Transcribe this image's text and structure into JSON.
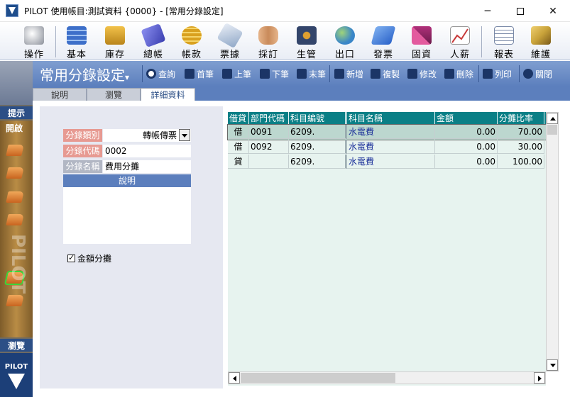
{
  "window": {
    "title": "PILOT 使用帳目:測試資料 {0000} - [常用分錄設定]",
    "controls": {
      "minimize": "─",
      "close": "✕"
    }
  },
  "toolbar": {
    "items": [
      {
        "label": "操作",
        "icon": "mouse-icon",
        "color": "#8a8f99"
      },
      {
        "label": "基本",
        "icon": "grid-icon",
        "color": "#3d6fc9"
      },
      {
        "label": "庫存",
        "icon": "box-icon",
        "color": "#d8a528"
      },
      {
        "label": "總帳",
        "icon": "book-icon",
        "color": "#5b5fc8"
      },
      {
        "label": "帳款",
        "icon": "coins-icon",
        "color": "#d9a11f"
      },
      {
        "label": "票據",
        "icon": "note-icon",
        "color": "#8fa7c7"
      },
      {
        "label": "採訂",
        "icon": "handshake-icon",
        "color": "#c98a5a"
      },
      {
        "label": "生管",
        "icon": "gear-icon",
        "color": "#33456b"
      },
      {
        "label": "出口",
        "icon": "globe-icon",
        "color": "#3a86c8"
      },
      {
        "label": "發票",
        "icon": "invoice-icon",
        "color": "#2a62c9"
      },
      {
        "label": "固資",
        "icon": "chart-bars-icon",
        "color": "#b0307a"
      },
      {
        "label": "人薪",
        "icon": "line-chart-icon",
        "color": "#c83a3a"
      },
      {
        "label": "報表",
        "icon": "report-icon",
        "color": "#7b8aa8"
      },
      {
        "label": "維護",
        "icon": "wrench-icon",
        "color": "#c8a23a"
      }
    ]
  },
  "leftnav": {
    "hint": "提示",
    "open": "開啟",
    "watermark": "PILOT",
    "browse": "瀏覽",
    "brand": "PILOT"
  },
  "module": {
    "title": "常用分錄設定",
    "title_suffix": "▾",
    "actions": [
      {
        "label": "查詢",
        "icon": "search-icon"
      },
      {
        "label": "首筆",
        "icon": "first-record-icon"
      },
      {
        "label": "上筆",
        "icon": "prev-record-icon"
      },
      {
        "label": "下筆",
        "icon": "next-record-icon"
      },
      {
        "label": "末筆",
        "icon": "last-record-icon"
      },
      {
        "label": "新增",
        "icon": "new-doc-icon"
      },
      {
        "label": "複製",
        "icon": "copy-icon"
      },
      {
        "label": "修改",
        "icon": "edit-icon"
      },
      {
        "label": "刪除",
        "icon": "trash-icon"
      },
      {
        "label": "列印",
        "icon": "printer-icon"
      },
      {
        "label": "關閉",
        "icon": "close-circle-icon"
      }
    ]
  },
  "tabs": [
    {
      "label": "說明"
    },
    {
      "label": "瀏覽"
    },
    {
      "label": "詳細資料"
    }
  ],
  "form": {
    "type_label": "分錄類別",
    "type_value": "轉帳傳票",
    "code_label": "分錄代碼",
    "code_value": "0002",
    "name_label": "分錄名稱",
    "name_value": "費用分攤",
    "desc_label": "說明",
    "desc_value": "",
    "amount_split_label": "金額分攤",
    "amount_split_checked": true
  },
  "grid": {
    "columns": [
      "借貸",
      "部門代碼",
      "科目編號",
      "科目名稱",
      "金額",
      "分攤比率"
    ],
    "rows": [
      {
        "dc": "借",
        "dept": "0091",
        "acct": "6209.",
        "name": "水電費",
        "amount": "0.00",
        "ratio": "70.00"
      },
      {
        "dc": "借",
        "dept": "0092",
        "acct": "6209.",
        "name": "水電費",
        "amount": "0.00",
        "ratio": "30.00"
      },
      {
        "dc": "貸",
        "dept": "",
        "acct": "6209.",
        "name": "水電費",
        "amount": "0.00",
        "ratio": "100.00"
      }
    ]
  }
}
